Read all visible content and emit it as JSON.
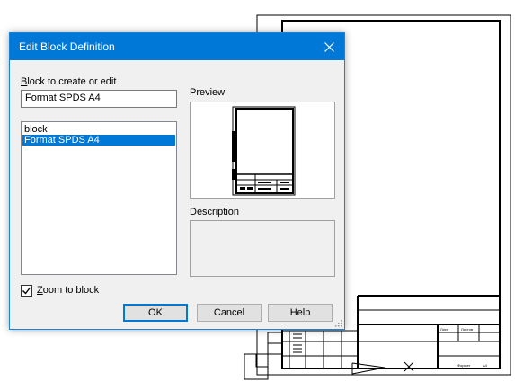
{
  "dialog": {
    "title": "Edit Block Definition",
    "block_label_prefix": "B",
    "block_label_rest": "lock to create or edit",
    "block_name_value": "Format SPDS A4",
    "block_list": [
      {
        "label": "block",
        "selected": false
      },
      {
        "label": "Format SPDS A4",
        "selected": true
      }
    ],
    "preview_label": "Preview",
    "description_label": "Description",
    "zoom_label_prefix": "Z",
    "zoom_label_rest": "oom to block",
    "zoom_checked": true,
    "ok_label": "OK",
    "cancel_label": "Cancel",
    "help_label": "Help"
  },
  "drawing": {
    "title_block_text_1": "Лист",
    "title_block_text_2": "Листов",
    "title_block_text_3": "Формат",
    "title_block_text_4": "A4"
  },
  "colors": {
    "titlebar": "#0078d7",
    "selection": "#0078d7",
    "dialog_bg": "#f0f0f0"
  }
}
